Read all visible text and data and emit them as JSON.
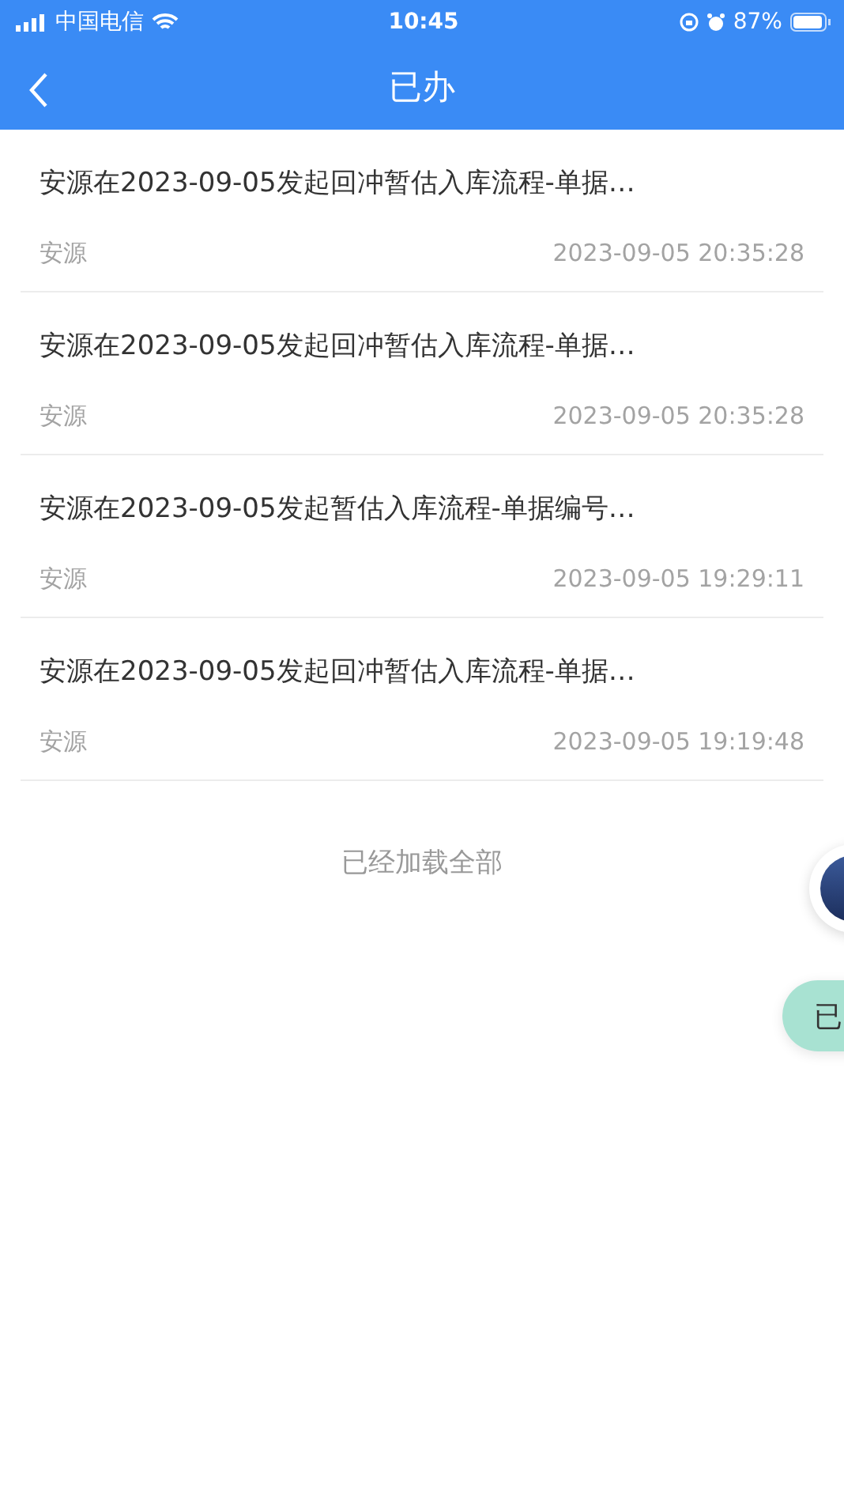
{
  "status_bar": {
    "carrier": "中国电信",
    "time": "10:45",
    "battery": "87%"
  },
  "nav": {
    "title": "已办"
  },
  "items": [
    {
      "title": "安源在2023-09-05发起回冲暂估入库流程-单据…",
      "author": "安源",
      "time": "2023-09-05 20:35:28"
    },
    {
      "title": "安源在2023-09-05发起回冲暂估入库流程-单据…",
      "author": "安源",
      "time": "2023-09-05 20:35:28"
    },
    {
      "title": "安源在2023-09-05发起暂估入库流程-单据编号…",
      "author": "安源",
      "time": "2023-09-05 19:29:11"
    },
    {
      "title": "安源在2023-09-05发起回冲暂估入库流程-单据…",
      "author": "安源",
      "time": "2023-09-05 19:19:48"
    }
  ],
  "footer": "已经加载全部",
  "floating_tab": {
    "label": "已"
  }
}
